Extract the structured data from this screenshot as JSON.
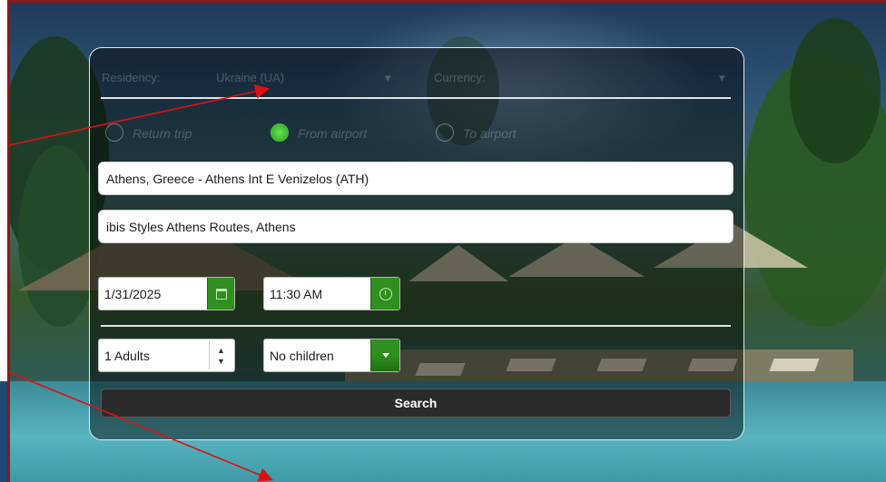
{
  "top_row": {
    "residency_label": "Residency:",
    "residency_value": "Ukraine (UA)",
    "currency_label": "Currency:"
  },
  "trip_type": {
    "options": [
      {
        "label": "Return trip",
        "checked": false
      },
      {
        "label": "From airport",
        "checked": true
      },
      {
        "label": "To airport",
        "checked": false
      }
    ]
  },
  "pickup": {
    "value": "Athens, Greece - Athens Int E Venizelos (ATH)"
  },
  "dropoff": {
    "value": "ibis Styles Athens Routes, Athens"
  },
  "date": {
    "value": "1/31/2025",
    "icon": "calendar-icon"
  },
  "time": {
    "value": "11:30 AM",
    "icon": "clock-icon"
  },
  "adults": {
    "value": "1 Adults",
    "up": "▲",
    "down": "▼"
  },
  "children": {
    "value": "No children"
  },
  "search_button": {
    "label": "Search"
  },
  "colors": {
    "accent_green": "#2f8f1f",
    "annotation_red": "#e01010"
  }
}
